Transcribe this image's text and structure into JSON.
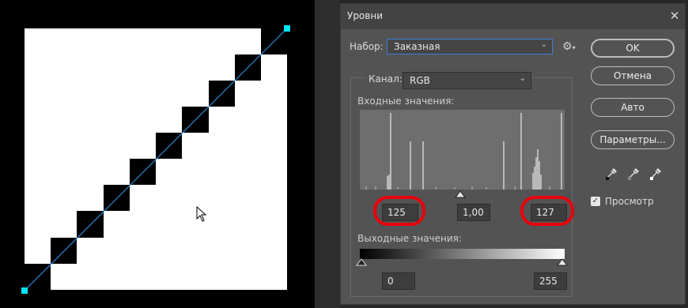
{
  "dialog": {
    "title": "Уровни",
    "close_icon": "close-icon"
  },
  "preset": {
    "label": "Набор:",
    "value": "Заказная"
  },
  "channel": {
    "label": "Канал:",
    "value": "RGB"
  },
  "input": {
    "label": "Входные значения:",
    "black": "125",
    "gamma": "1,00",
    "white": "127"
  },
  "output": {
    "label": "Выходные значения:",
    "black": "0",
    "white": "255"
  },
  "buttons": {
    "ok": "OK",
    "cancel": "Отмена",
    "auto": "Авто",
    "params": "Параметры..."
  },
  "preview": {
    "label": "Просмотр",
    "checked": true
  },
  "colors": {
    "accent_line": "#3399ff",
    "handle": "#00e5ff",
    "highlight_ring": "#e8000c"
  }
}
